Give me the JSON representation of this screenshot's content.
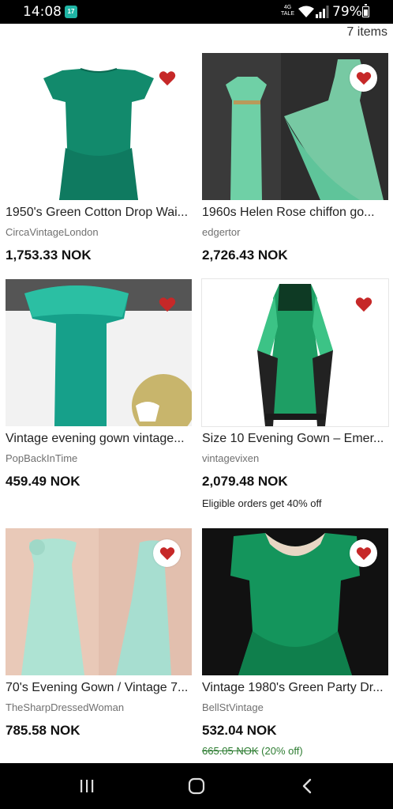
{
  "status_bar": {
    "time": "14:08",
    "app_icon_label": "17",
    "network": "4G",
    "network_sub": "TALE",
    "battery": "79%"
  },
  "results": {
    "count_label": "7 items"
  },
  "colors": {
    "heart": "#c62828",
    "discount": "#2e7d32"
  },
  "items": [
    {
      "title": "1950's Green Cotton Drop Wai...",
      "seller": "CircaVintageLondon",
      "price": "1,753.33 NOK"
    },
    {
      "title": "1960s Helen Rose chiffon go...",
      "seller": "edgertor",
      "price": "2,726.43 NOK"
    },
    {
      "title": "Vintage evening gown vintage...",
      "seller": "PopBackInTime",
      "price": "459.49 NOK"
    },
    {
      "title": "Size 10 Evening Gown – Emer...",
      "seller": "vintagevixen",
      "price": "2,079.48 NOK",
      "promo": "Eligible orders get 40% off"
    },
    {
      "title": "70's Evening Gown / Vintage 7...",
      "seller": "TheSharpDressedWoman",
      "price": "785.58 NOK"
    },
    {
      "title": "Vintage 1980's Green Party Dr...",
      "seller": "BellStVintage",
      "price": "532.04 NOK",
      "original_price": "665.05 NOK",
      "discount": "(20% off)"
    }
  ],
  "nav": {
    "icons": [
      "recent-apps-icon",
      "home-icon",
      "back-icon"
    ]
  }
}
